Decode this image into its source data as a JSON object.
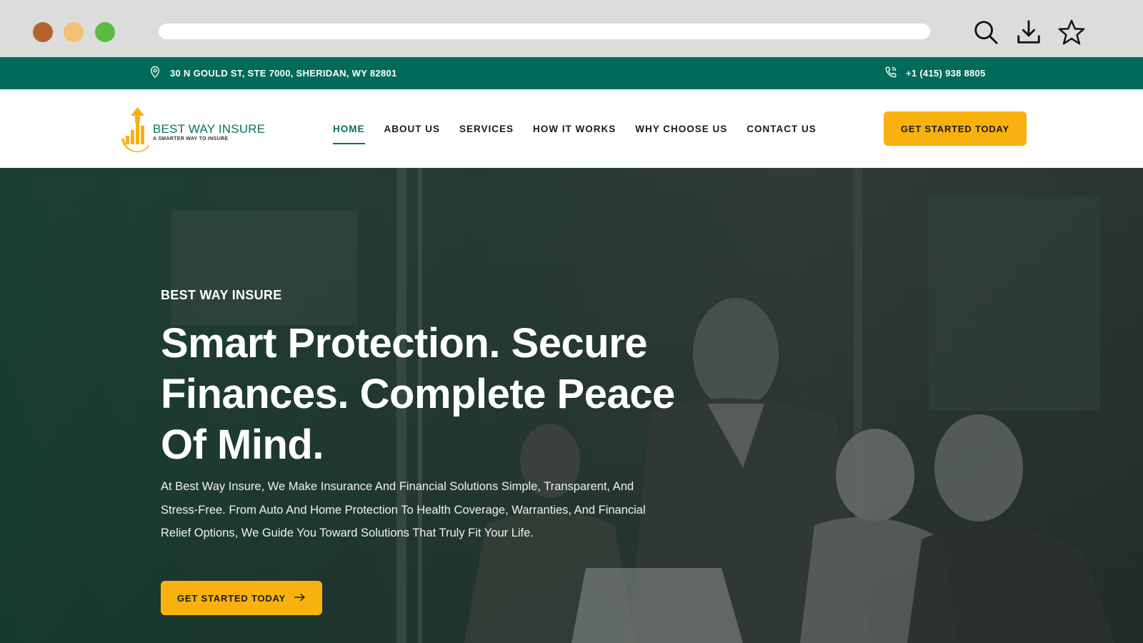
{
  "browser": {
    "icons": [
      "search-icon",
      "download-icon",
      "star-icon"
    ]
  },
  "topbar": {
    "address": "30 N GOULD ST, STE 7000, SHERIDAN, WY 82801",
    "phone": "+1 (415) 938 8805",
    "background": "#006b5a"
  },
  "header": {
    "logo": {
      "name": "BEST WAY INSURE",
      "tagline": "A SMARTER WAY TO INSURE"
    },
    "nav": [
      {
        "label": "HOME",
        "active": true
      },
      {
        "label": "ABOUT US"
      },
      {
        "label": "SERVICES"
      },
      {
        "label": "HOW IT WORKS"
      },
      {
        "label": "WHY CHOOSE US"
      },
      {
        "label": "CONTACT US"
      }
    ],
    "cta_label": "GET STARTED TODAY"
  },
  "hero": {
    "eyebrow": "BEST WAY INSURE",
    "title": "Smart Protection. Secure Finances. Complete Peace Of Mind.",
    "description": "At Best Way Insure, We Make Insurance And Financial Solutions Simple, Transparent, And Stress-Free. From Auto And Home Protection To Health Coverage, Warranties, And Financial Relief Options, We Guide You Toward Solutions That Truly Fit Your Life.",
    "cta_label": "GET STARTED TODAY"
  },
  "colors": {
    "accent": "#f9b10f",
    "brand_green": "#006b5a"
  }
}
